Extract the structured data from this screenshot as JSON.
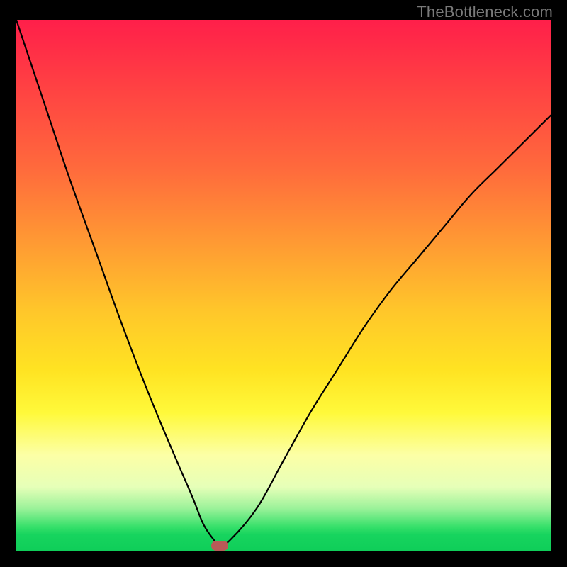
{
  "attribution": "TheBottleneck.com",
  "chart_data": {
    "type": "line",
    "title": "",
    "xlabel": "",
    "ylabel": "",
    "xlim": [
      0,
      100
    ],
    "ylim": [
      0,
      100
    ],
    "series": [
      {
        "name": "bottleneck-curve",
        "x": [
          0,
          5,
          10,
          15,
          20,
          25,
          30,
          33,
          35,
          37,
          38,
          40,
          45,
          50,
          55,
          60,
          65,
          70,
          75,
          80,
          85,
          90,
          95,
          100
        ],
        "y": [
          100,
          85,
          70,
          56,
          42,
          29,
          17,
          10,
          5,
          2,
          1,
          2,
          8,
          17,
          26,
          34,
          42,
          49,
          55,
          61,
          67,
          72,
          77,
          82
        ]
      }
    ],
    "marker": {
      "x": 38,
      "y": 1
    },
    "gradient_stops": [
      {
        "pct": 0,
        "color": "#ff1f4a"
      },
      {
        "pct": 28,
        "color": "#ff6a3c"
      },
      {
        "pct": 55,
        "color": "#ffc72a"
      },
      {
        "pct": 74,
        "color": "#fff93a"
      },
      {
        "pct": 92,
        "color": "#9cf29a"
      },
      {
        "pct": 100,
        "color": "#0fce59"
      }
    ]
  }
}
